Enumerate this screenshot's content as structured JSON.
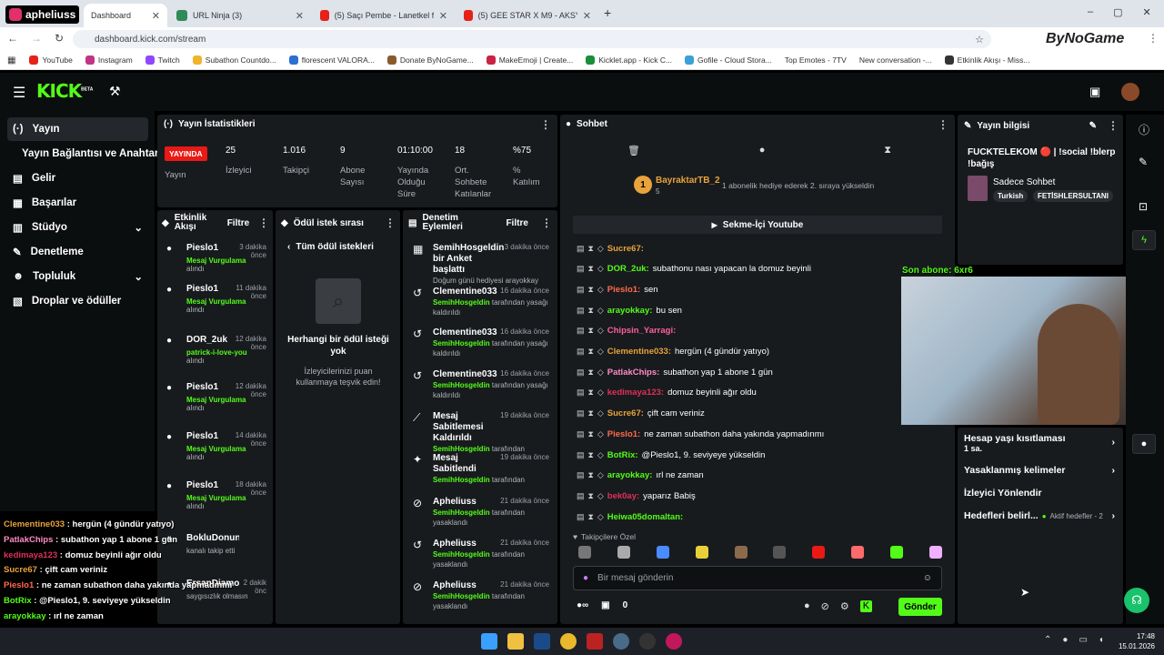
{
  "browser": {
    "tabs": [
      {
        "label": "Dashboard",
        "active": true
      },
      {
        "label": "URL Ninja (3)"
      },
      {
        "label": "(5) Saçı Pembe - Lanetkel feat l..."
      },
      {
        "label": "(5) GEE STAR X M9 - AKSYON ..."
      }
    ],
    "url": "dashboard.kick.com/stream",
    "bookmarks": [
      "YouTube",
      "Instagram",
      "Twitch",
      "Subathon Countdo...",
      "florescent VALORA...",
      "Donate ByNoGame...",
      "MakeEmoji | Create...",
      "Kicklet.app - Kick C...",
      "Gofile - Cloud Stora...",
      "Top Emotes - 7TV",
      "New conversation -...",
      "Etkinlik Akışı - Miss..."
    ],
    "overlay_user": "apheliuss",
    "brand": "ByNoGame"
  },
  "kick": {
    "logo": "KICK",
    "beta": "BETA",
    "sidebar": [
      {
        "label": "Yayın",
        "icon": "signal-icon"
      },
      {
        "label": "Yayın Bağlantısı ve Anahtarı",
        "icon": ""
      },
      {
        "label": "Gelir",
        "icon": "wallet-icon"
      },
      {
        "label": "Başarılar",
        "icon": "trophy-icon"
      },
      {
        "label": "Stüdyo",
        "icon": "studio-icon"
      },
      {
        "label": "Denetleme",
        "icon": "wrench-icon"
      },
      {
        "label": "Topluluk",
        "icon": "users-icon"
      },
      {
        "label": "Droplar ve ödüller",
        "icon": "gift-icon"
      }
    ],
    "stats": {
      "title": "Yayın İstatistikleri",
      "live": "YAYINDA",
      "live_label": "Yayın",
      "items": [
        {
          "v": "25",
          "l": "İzleyici"
        },
        {
          "v": "1.016",
          "l": "Takipçi"
        },
        {
          "v": "9",
          "l": "Abone Sayısı"
        },
        {
          "v": "01:10:00",
          "l": "Yayında Olduğu Süre"
        },
        {
          "v": "18",
          "l": "Ort. Sohbete Katılanlar"
        },
        {
          "v": "%75",
          "l": "% Katılım"
        }
      ]
    },
    "activity": {
      "title": "Etkinlik Akışı",
      "filter": "Filtre",
      "items": [
        {
          "n": "Pieslo1",
          "t": "3 dakika önce",
          "s": "Mesaj Vurgulama",
          "a": "alındı"
        },
        {
          "n": "Pieslo1",
          "t": "11 dakika önce",
          "s": "Mesaj Vurgulama",
          "a": "alındı"
        },
        {
          "n": "DOR_2uk",
          "t": "12 dakika önce",
          "s": "patrick-i-love-you",
          "a": "alındı"
        },
        {
          "n": "Pieslo1",
          "t": "12 dakika önce",
          "s": "Mesaj Vurgulama",
          "a": "alındı"
        },
        {
          "n": "Pieslo1",
          "t": "14 dakika önce",
          "s": "Mesaj Vurgulama",
          "a": "alındı"
        },
        {
          "n": "Pieslo1",
          "t": "18 dakika önce",
          "s": "Mesaj Vurgulama",
          "a": "alındı"
        },
        {
          "n": "BokluDonunuArzul",
          "t": "",
          "s": "",
          "a": "kanalı takip etti"
        },
        {
          "n": "ErsanDiamond",
          "t": "2 dakik önc",
          "s": "",
          "a": "saygısızlık olmasın"
        }
      ]
    },
    "rewards": {
      "title": "Ödül istek sırası",
      "all": "Tüm ödül istekleri",
      "empty_title": "Herhangi bir ödül isteği yok",
      "empty_sub": "İzleyicilerinizi puan kullanmaya teşvik edin!"
    },
    "modlog": {
      "title": "Denetim Eylemleri",
      "filter": "Filtre",
      "items": [
        {
          "n": "SemihHosgeldin bir Anket başlattı",
          "t": "3 dakika önce",
          "s": "Doğum günü hediyesi arayokkay",
          "g": ""
        },
        {
          "n": "Clementine033",
          "t": "16 dakika önce",
          "s": "tarafından yasağı kaldırıldı",
          "g": "SemihHosgeldin"
        },
        {
          "n": "Clementine033",
          "t": "16 dakika önce",
          "s": "tarafından yasağı kaldırıldı",
          "g": "SemihHosgeldin"
        },
        {
          "n": "Clementine033",
          "t": "16 dakika önce",
          "s": "tarafından yasağı kaldırıldı",
          "g": "SemihHosgeldin"
        },
        {
          "n": "Mesaj Sabitlemesi Kaldırıldı",
          "t": "19 dakika önce",
          "s": "tarafından",
          "g": "SemihHosgeldin"
        },
        {
          "n": "Mesaj Sabitlendi",
          "t": "19 dakika önce",
          "s": "tarafından",
          "g": "SemihHosgeldin"
        },
        {
          "n": "Apheliuss",
          "t": "21 dakika önce",
          "s": "tarafından yasaklandı",
          "g": "SemihHosgeldin"
        },
        {
          "n": "Apheliuss",
          "t": "21 dakika önce",
          "s": "tarafından yasaklandı",
          "g": "SemihHosgeldin"
        },
        {
          "n": "Apheliuss",
          "t": "21 dakika önce",
          "s": "tarafından yasaklandı",
          "g": "SemihHosgeldin"
        }
      ]
    },
    "chat": {
      "title": "Sohbet",
      "pinned_user": "BayraktarTB_2",
      "pinned_rank": "1",
      "pinned_sub": "5",
      "pinned_msg": "1 abonelik hediye ederek 2. sıraya yükseldin",
      "tab": "Sekme-İçi Youtube",
      "messages": [
        {
          "u": "Sucre67:",
          "m": "",
          "c": "#e8a33a"
        },
        {
          "u": "DOR_2uk:",
          "m": "subathonu nası yapacan la domuz beyinli",
          "c": "#53fc18"
        },
        {
          "u": "Pieslo1:",
          "m": "sen",
          "c": "#ff6a4d"
        },
        {
          "u": "arayokkay:",
          "m": "bu sen",
          "c": "#53fc18"
        },
        {
          "u": "Chipsin_Yarragi:",
          "m": "",
          "c": "#ff5fa0"
        },
        {
          "u": "Clementine033:",
          "m": "hergün (4 gündür yatıyo)",
          "c": "#e8a33a"
        },
        {
          "u": "PatlakChips:",
          "m": "subathon yap 1 abone 1 gün",
          "c": "#ff8cc6"
        },
        {
          "u": "kedimaya123:",
          "m": "domuz beyinli ağır oldu",
          "c": "#e0305a"
        },
        {
          "u": "Sucre67:",
          "m": "çift cam veriniz",
          "c": "#e8a33a"
        },
        {
          "u": "Pieslo1:",
          "m": "ne zaman subathon daha yakında yapmadınmı",
          "c": "#ff6a4d"
        },
        {
          "u": "BotRix:",
          "m": "@Pieslo1, 9. seviyeye yükseldin",
          "c": "#53fc18"
        },
        {
          "u": "arayokkay:",
          "m": "ırl ne zaman",
          "c": "#53fc18"
        },
        {
          "u": "bek0ay:",
          "m": "yaparız Babiş",
          "c": "#e0305a"
        },
        {
          "u": "Heiwa05domaltan:",
          "m": "",
          "c": "#53fc18"
        }
      ],
      "emote_label": "Takipçilere Özel",
      "placeholder": "Bir mesaj gönderin",
      "points": "0",
      "send": "Gönder"
    },
    "info": {
      "title": "Yayın bilgisi",
      "stream_title": "FUCKTELEKOM 🔴 | !social !blerp !bağış",
      "category": "Sadece Sohbet",
      "tags": [
        "Turkish",
        "FETİSHLERSULTANI"
      ],
      "sub_goal": "Son abone: 6xr6",
      "settings": [
        {
          "label": "Hesap yaşı kısıtlaması",
          "sub": "1 sa."
        },
        {
          "label": "Yasaklanmış kelimeler",
          "sub": ""
        },
        {
          "label": "İzleyici Yönlendir",
          "sub": ""
        },
        {
          "label": "Hedefleri belirl...",
          "sub": "",
          "extra": "Aktif hedefler - 2"
        }
      ]
    },
    "overlay_chat": [
      {
        "u": "Clementine033",
        "m": "hergün (4 gündür yatıyo)",
        "c": "#e8a33a"
      },
      {
        "u": "PatlakChips",
        "m": "subathon yap 1 abone 1 gün",
        "c": "#ff8cc6"
      },
      {
        "u": "kedimaya123",
        "m": "domuz beyinli ağır oldu",
        "c": "#e0305a"
      },
      {
        "u": "Sucre67",
        "m": "çift cam veriniz",
        "c": "#e8a33a"
      },
      {
        "u": "Pieslo1",
        "m": "ne zaman subathon daha yakında yapmadınmı",
        "c": "#ff6a4d"
      },
      {
        "u": "BotRix",
        "m": "@Pieslo1, 9. seviyeye yükseldin",
        "c": "#53fc18"
      },
      {
        "u": "arayokkay",
        "m": "ırl ne zaman",
        "c": "#53fc18"
      },
      {
        "u": "bek0ay",
        "m": "yaparız Babiş",
        "c": "#e0305a"
      },
      {
        "u": "Heiwa05domaltan",
        "m": "",
        "c": "#53fc18"
      }
    ]
  },
  "taskbar": {
    "time": "17:48",
    "date": "15.01.2026"
  },
  "colors": {
    "accent": "#53fc18",
    "live": "#e91916",
    "panel": "#181b1e",
    "bg": "#000000"
  }
}
